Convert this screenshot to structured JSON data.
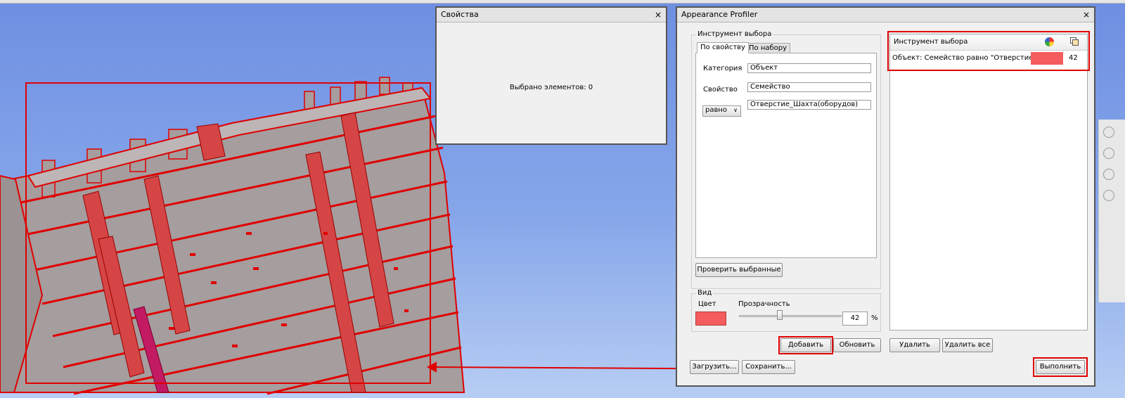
{
  "properties_panel": {
    "title": "Свойства",
    "status": "Выбрано элементов: 0"
  },
  "profiler": {
    "title": "Appearance Profiler",
    "selection_group": "Инструмент выбора",
    "tabs": [
      {
        "label": "По свойству",
        "active": true
      },
      {
        "label": "По набору",
        "active": false
      }
    ],
    "category_label": "Категория",
    "category_value": "Объект",
    "property_label": "Свойство",
    "property_value": "Семейство",
    "operator_value": "равно",
    "value_value": "Отверстие_Шахта(оборудов)",
    "check_button": "Проверить выбранные",
    "view_group": "Вид",
    "color_label": "Цвет",
    "transparency_label": "Прозрачность",
    "transparency_value": "42",
    "transparency_unit": "%",
    "transparency_fraction": 0.42,
    "add_button": "Добавить",
    "update_button": "Обновить",
    "delete_button": "Удалить",
    "delete_all_button": "Удалить все",
    "load_button": "Загрузить...",
    "save_button": "Сохранить...",
    "run_button": "Выполнить",
    "list": {
      "header": "Инструмент выбора",
      "rows": [
        {
          "text": "Объект: Семейство равно \"Отверстие_...",
          "transparency": "42"
        }
      ]
    },
    "accent_color": "#f35d5d",
    "highlight_color": "#e00000"
  },
  "close_glyph": "×"
}
